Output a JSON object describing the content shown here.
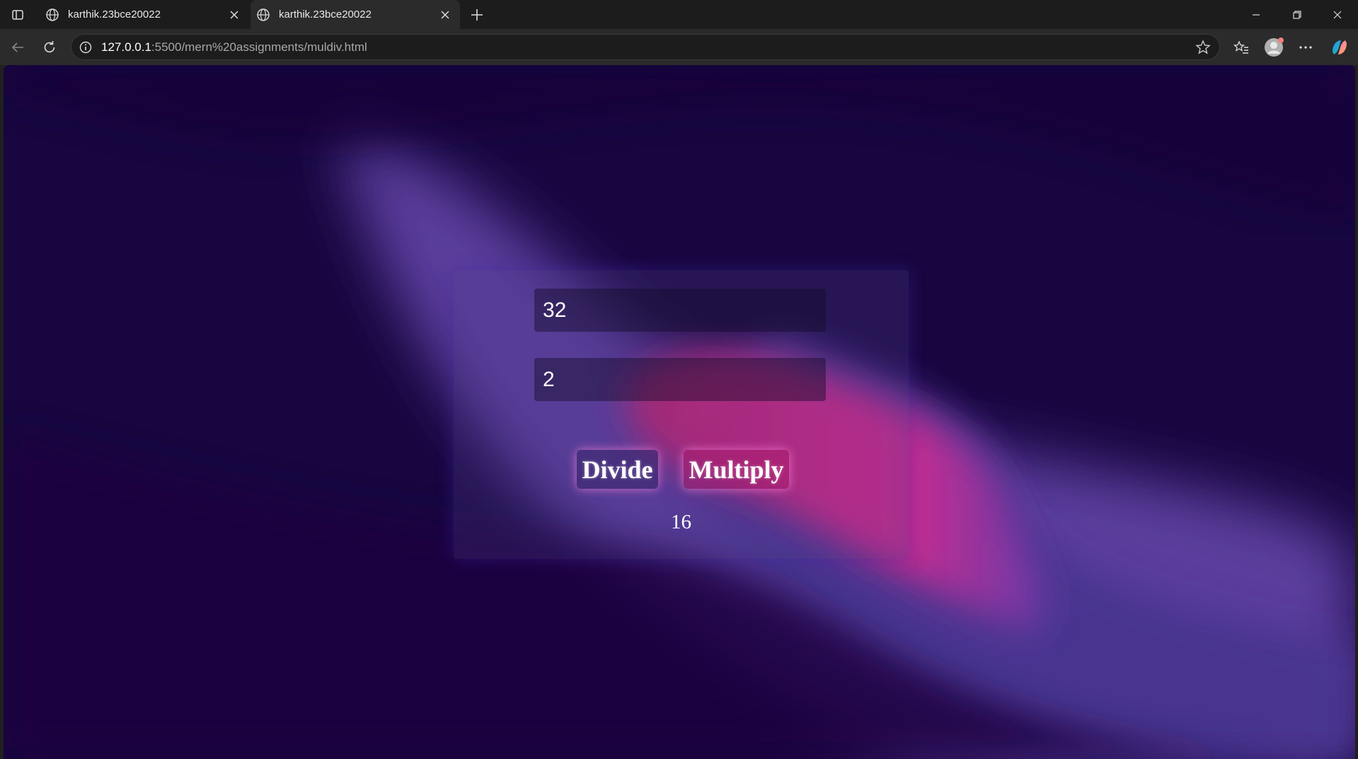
{
  "browser": {
    "tabs": [
      {
        "label": "karthik.23bce20022",
        "active": false
      },
      {
        "label": "karthik.23bce20022",
        "active": true
      }
    ],
    "url": {
      "host": "127.0.0.1",
      "rest": ":5500/mern%20assignments/muldiv.html"
    },
    "icons": [
      "sidebar-toggle-icon",
      "globe-icon",
      "close-icon",
      "plus-icon",
      "minimize-icon",
      "restore-icon",
      "back-icon",
      "reload-icon",
      "info-icon",
      "star-icon",
      "favorites-icon",
      "profile-icon",
      "more-icon",
      "copilot-icon"
    ]
  },
  "page": {
    "input1_value": "32",
    "input2_value": "2",
    "divide_label": "Divide",
    "multiply_label": "Multiply",
    "result": "16"
  },
  "colors": {
    "background_dark": "#180640",
    "wave_purple": "#5a3a9a",
    "wave_pink": "#d0207a",
    "text": "#ffffff"
  }
}
